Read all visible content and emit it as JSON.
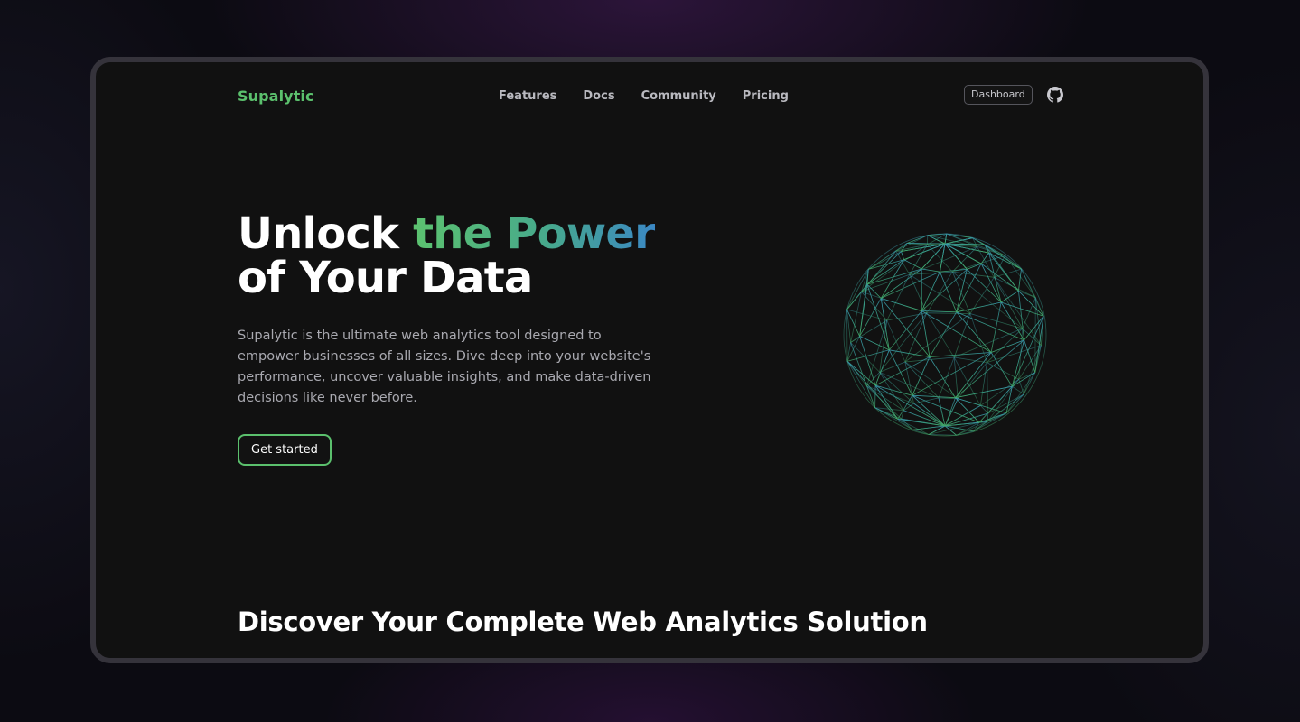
{
  "nav": {
    "brand": "Supalytic",
    "links": [
      "Features",
      "Docs",
      "Community",
      "Pricing"
    ],
    "dashboard_label": "Dashboard",
    "github_icon": "github-icon"
  },
  "hero": {
    "title_plain_1": "Unlock ",
    "title_gradient": "the Power",
    "title_line_2": "of Your Data",
    "description": "Supalytic is the ultimate web analytics tool designed to empower businesses of all sizes. Dive deep into your website's performance, uncover valuable insights, and make data-driven decisions like never before.",
    "cta_label": "Get started",
    "illustration": "wireframe-globe"
  },
  "section": {
    "title": "Discover Your Complete Web Analytics Solution"
  },
  "colors": {
    "accent_green": "#5bc06d",
    "accent_blue": "#3b88c4",
    "background": "#111111"
  }
}
